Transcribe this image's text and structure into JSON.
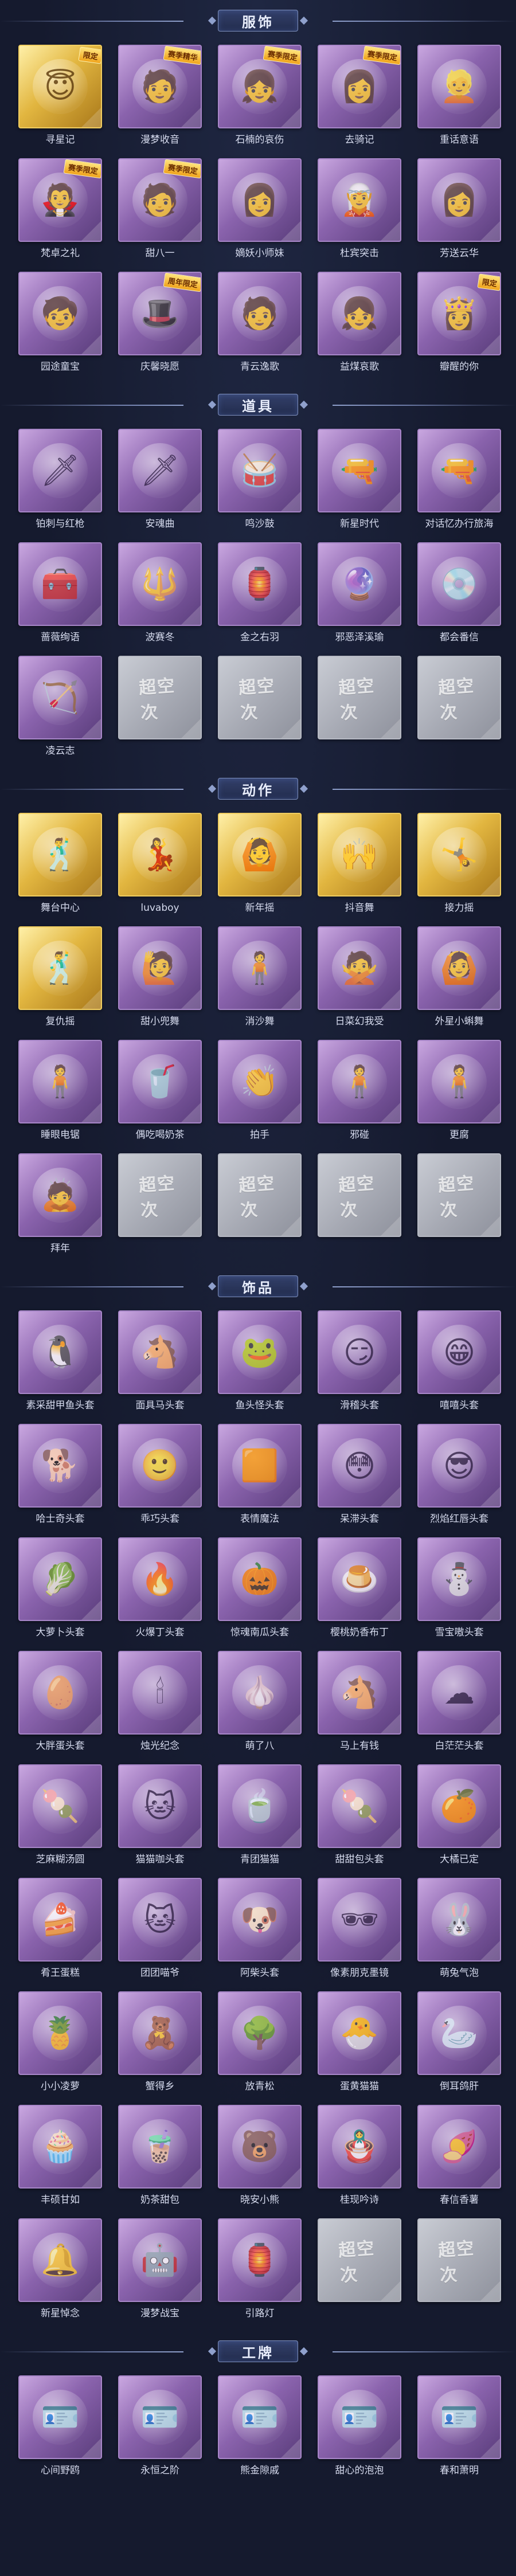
{
  "sections": [
    {
      "key": "costumes",
      "title": "服饰",
      "items": [
        {
          "label": "寻星记",
          "icon": "😇",
          "variant": "gold",
          "tag": "限定"
        },
        {
          "label": "漫梦收音",
          "icon": "🧑",
          "variant": "purple",
          "tag": "赛季精华"
        },
        {
          "label": "石楠的哀伤",
          "icon": "👧",
          "variant": "purple",
          "tag": "赛季限定"
        },
        {
          "label": "去骑记",
          "icon": "👩",
          "variant": "purple",
          "tag": "赛季限定"
        },
        {
          "label": "重话意语",
          "icon": "👱",
          "variant": "purple",
          "tag": ""
        },
        {
          "label": "梵卓之礼",
          "icon": "🧛",
          "variant": "purple",
          "tag": "赛季限定"
        },
        {
          "label": "甜八一",
          "icon": "🧑",
          "variant": "purple",
          "tag": "赛季限定"
        },
        {
          "label": "嫡妖小师妹",
          "icon": "👩",
          "variant": "purple",
          "tag": ""
        },
        {
          "label": "杜宾突击",
          "icon": "🧝",
          "variant": "purple",
          "tag": ""
        },
        {
          "label": "芳送云华",
          "icon": "👩",
          "variant": "purple",
          "tag": ""
        },
        {
          "label": "园途童宝",
          "icon": "🧒",
          "variant": "purple",
          "tag": ""
        },
        {
          "label": "庆馨晓愿",
          "icon": "🎩",
          "variant": "purple",
          "tag": "周年限定"
        },
        {
          "label": "青云逸歌",
          "icon": "🧑",
          "variant": "purple",
          "tag": ""
        },
        {
          "label": "益煤哀歌",
          "icon": "👧",
          "variant": "purple",
          "tag": ""
        },
        {
          "label": "瓣醒的你",
          "icon": "👸",
          "variant": "purple",
          "tag": "限定"
        }
      ]
    },
    {
      "key": "props",
      "title": "道具",
      "items": [
        {
          "label": "铂刺与红枪",
          "icon": "🗡",
          "variant": "purple",
          "tag": ""
        },
        {
          "label": "安魂曲",
          "icon": "🗡",
          "variant": "purple",
          "tag": ""
        },
        {
          "label": "鸣沙鼓",
          "icon": "🥁",
          "variant": "purple",
          "tag": ""
        },
        {
          "label": "新星时代",
          "icon": "🔫",
          "variant": "purple",
          "tag": ""
        },
        {
          "label": "对话忆办行旅海",
          "icon": "🔫",
          "variant": "purple",
          "tag": ""
        },
        {
          "label": "蔷薇绚语",
          "icon": "🧰",
          "variant": "purple",
          "tag": ""
        },
        {
          "label": "波赛冬",
          "icon": "🔱",
          "variant": "purple",
          "tag": ""
        },
        {
          "label": "金之右羽",
          "icon": "🏮",
          "variant": "purple",
          "tag": ""
        },
        {
          "label": "邪恶泽溪瑜",
          "icon": "🔮",
          "variant": "purple",
          "tag": ""
        },
        {
          "label": "都会番信",
          "icon": "💿",
          "variant": "purple",
          "tag": ""
        },
        {
          "label": "凌云志",
          "icon": "🏹",
          "variant": "purple",
          "tag": ""
        },
        {
          "label": "",
          "icon": "",
          "variant": "empty",
          "tag": "",
          "watermark": "超空次"
        },
        {
          "label": "",
          "icon": "",
          "variant": "empty",
          "tag": "",
          "watermark": "超空次"
        },
        {
          "label": "",
          "icon": "",
          "variant": "empty",
          "tag": "",
          "watermark": "超空次"
        },
        {
          "label": "",
          "icon": "",
          "variant": "empty",
          "tag": "",
          "watermark": "超空次"
        }
      ]
    },
    {
      "key": "emotes",
      "title": "动作",
      "items": [
        {
          "label": "舞台中心",
          "icon": "🕺",
          "variant": "gold",
          "tag": ""
        },
        {
          "label": "luvaboy",
          "icon": "💃",
          "variant": "gold",
          "tag": ""
        },
        {
          "label": "新年摇",
          "icon": "🙆",
          "variant": "gold",
          "tag": ""
        },
        {
          "label": "抖音舞",
          "icon": "🙌",
          "variant": "gold",
          "tag": ""
        },
        {
          "label": "接力摇",
          "icon": "🤸",
          "variant": "gold",
          "tag": ""
        },
        {
          "label": "复仇摇",
          "icon": "🕺",
          "variant": "gold",
          "tag": ""
        },
        {
          "label": "甜小兜舞",
          "icon": "🙋",
          "variant": "purple",
          "tag": ""
        },
        {
          "label": "消沙舞",
          "icon": "🧍",
          "variant": "purple",
          "tag": ""
        },
        {
          "label": "日菜幻我受",
          "icon": "🙅",
          "variant": "purple",
          "tag": ""
        },
        {
          "label": "外星小蝌舞",
          "icon": "🙆",
          "variant": "purple",
          "tag": ""
        },
        {
          "label": "睡眼电锯",
          "icon": "🧍",
          "variant": "purple",
          "tag": ""
        },
        {
          "label": "偶吃喝奶茶",
          "icon": "🥤",
          "variant": "purple",
          "tag": ""
        },
        {
          "label": "拍手",
          "icon": "👏",
          "variant": "purple",
          "tag": ""
        },
        {
          "label": "邪碰",
          "icon": "🧍",
          "variant": "purple",
          "tag": ""
        },
        {
          "label": "更腐",
          "icon": "🧍",
          "variant": "purple",
          "tag": ""
        },
        {
          "label": "拜年",
          "icon": "🙇",
          "variant": "purple",
          "tag": ""
        },
        {
          "label": "",
          "icon": "",
          "variant": "empty",
          "tag": "",
          "watermark": "超空次"
        },
        {
          "label": "",
          "icon": "",
          "variant": "empty",
          "tag": "",
          "watermark": "超空次"
        },
        {
          "label": "",
          "icon": "",
          "variant": "empty",
          "tag": "",
          "watermark": "超空次"
        },
        {
          "label": "",
          "icon": "",
          "variant": "empty",
          "tag": "",
          "watermark": "超空次"
        }
      ]
    },
    {
      "key": "accessories",
      "title": "饰品",
      "items": [
        {
          "label": "素采甜甲鱼头套",
          "icon": "🐧",
          "variant": "purple",
          "tag": ""
        },
        {
          "label": "面具马头套",
          "icon": "🐴",
          "variant": "purple",
          "tag": ""
        },
        {
          "label": "鱼头怪头套",
          "icon": "🐸",
          "variant": "purple",
          "tag": ""
        },
        {
          "label": "滑稽头套",
          "icon": "😏",
          "variant": "purple",
          "tag": ""
        },
        {
          "label": "嘻嘻头套",
          "icon": "😁",
          "variant": "purple",
          "tag": ""
        },
        {
          "label": "哈士奇头套",
          "icon": "🐕",
          "variant": "purple",
          "tag": ""
        },
        {
          "label": "乖巧头套",
          "icon": "🙂",
          "variant": "purple",
          "tag": ""
        },
        {
          "label": "表情魔法",
          "icon": "🟧",
          "variant": "purple",
          "tag": ""
        },
        {
          "label": "呆滞头套",
          "icon": "😳",
          "variant": "purple",
          "tag": ""
        },
        {
          "label": "烈焰红唇头套",
          "icon": "😎",
          "variant": "purple",
          "tag": ""
        },
        {
          "label": "大萝卜头套",
          "icon": "🥬",
          "variant": "purple",
          "tag": ""
        },
        {
          "label": "火爆丁头套",
          "icon": "🔥",
          "variant": "purple",
          "tag": ""
        },
        {
          "label": "惊魂南瓜头套",
          "icon": "🎃",
          "variant": "purple",
          "tag": ""
        },
        {
          "label": "樱桃奶香布丁",
          "icon": "🍮",
          "variant": "purple",
          "tag": ""
        },
        {
          "label": "雪宝嗷头套",
          "icon": "⛄",
          "variant": "purple",
          "tag": ""
        },
        {
          "label": "大胖蛋头套",
          "icon": "🥚",
          "variant": "purple",
          "tag": ""
        },
        {
          "label": "烛光纪念",
          "icon": "🕯",
          "variant": "purple",
          "tag": ""
        },
        {
          "label": "萌了八",
          "icon": "🧄",
          "variant": "purple",
          "tag": ""
        },
        {
          "label": "马上有钱",
          "icon": "🐴",
          "variant": "purple",
          "tag": ""
        },
        {
          "label": "白茫茫头套",
          "icon": "☁",
          "variant": "purple",
          "tag": ""
        },
        {
          "label": "芝麻糊汤圆",
          "icon": "🍡",
          "variant": "purple",
          "tag": ""
        },
        {
          "label": "猫猫咖头套",
          "icon": "🐱",
          "variant": "purple",
          "tag": ""
        },
        {
          "label": "青团猫猫",
          "icon": "🍵",
          "variant": "purple",
          "tag": ""
        },
        {
          "label": "甜甜包头套",
          "icon": "🍡",
          "variant": "purple",
          "tag": ""
        },
        {
          "label": "大橘已定",
          "icon": "🍊",
          "variant": "purple",
          "tag": ""
        },
        {
          "label": "肴王蛋糕",
          "icon": "🍰",
          "variant": "purple",
          "tag": ""
        },
        {
          "label": "团团喵爷",
          "icon": "🐱",
          "variant": "purple",
          "tag": ""
        },
        {
          "label": "阿柴头套",
          "icon": "🐶",
          "variant": "purple",
          "tag": ""
        },
        {
          "label": "像素朋克墨镜",
          "icon": "🕶",
          "variant": "purple",
          "tag": ""
        },
        {
          "label": "萌兔气泡",
          "icon": "🐰",
          "variant": "purple",
          "tag": ""
        },
        {
          "label": "小小凌萝",
          "icon": "🍍",
          "variant": "purple",
          "tag": ""
        },
        {
          "label": "蟹得乡",
          "icon": "🧸",
          "variant": "purple",
          "tag": ""
        },
        {
          "label": "放青松",
          "icon": "🌳",
          "variant": "purple",
          "tag": ""
        },
        {
          "label": "蛋黄猫猫",
          "icon": "🐣",
          "variant": "purple",
          "tag": ""
        },
        {
          "label": "倒耳鸽肝",
          "icon": "🦢",
          "variant": "purple",
          "tag": ""
        },
        {
          "label": "丰硕甘如",
          "icon": "🧁",
          "variant": "purple",
          "tag": ""
        },
        {
          "label": "奶茶甜包",
          "icon": "🧋",
          "variant": "purple",
          "tag": ""
        },
        {
          "label": "晓安小熊",
          "icon": "🐻",
          "variant": "purple",
          "tag": ""
        },
        {
          "label": "桂现吟诗",
          "icon": "🪆",
          "variant": "purple",
          "tag": ""
        },
        {
          "label": "春信香薯",
          "icon": "🍠",
          "variant": "purple",
          "tag": ""
        },
        {
          "label": "新星悼念",
          "icon": "🔔",
          "variant": "purple",
          "tag": ""
        },
        {
          "label": "漫梦战宝",
          "icon": "🤖",
          "variant": "purple",
          "tag": ""
        },
        {
          "label": "引路灯",
          "icon": "🏮",
          "variant": "purple",
          "tag": ""
        },
        {
          "label": "",
          "icon": "",
          "variant": "empty",
          "tag": "",
          "watermark": "超空次"
        },
        {
          "label": "",
          "icon": "",
          "variant": "empty",
          "tag": "",
          "watermark": "超空次"
        }
      ]
    },
    {
      "key": "badges",
      "title": "工牌",
      "items": [
        {
          "label": "心间野鸥",
          "icon": "🪪",
          "variant": "purple",
          "tag": ""
        },
        {
          "label": "永恒之阶",
          "icon": "🪪",
          "variant": "purple",
          "tag": ""
        },
        {
          "label": "熊金隙戚",
          "icon": "🪪",
          "variant": "purple",
          "tag": ""
        },
        {
          "label": "甜心的泡泡",
          "icon": "🪪",
          "variant": "purple",
          "tag": ""
        },
        {
          "label": "春和萧明",
          "icon": "🪪",
          "variant": "purple",
          "tag": ""
        }
      ]
    }
  ]
}
